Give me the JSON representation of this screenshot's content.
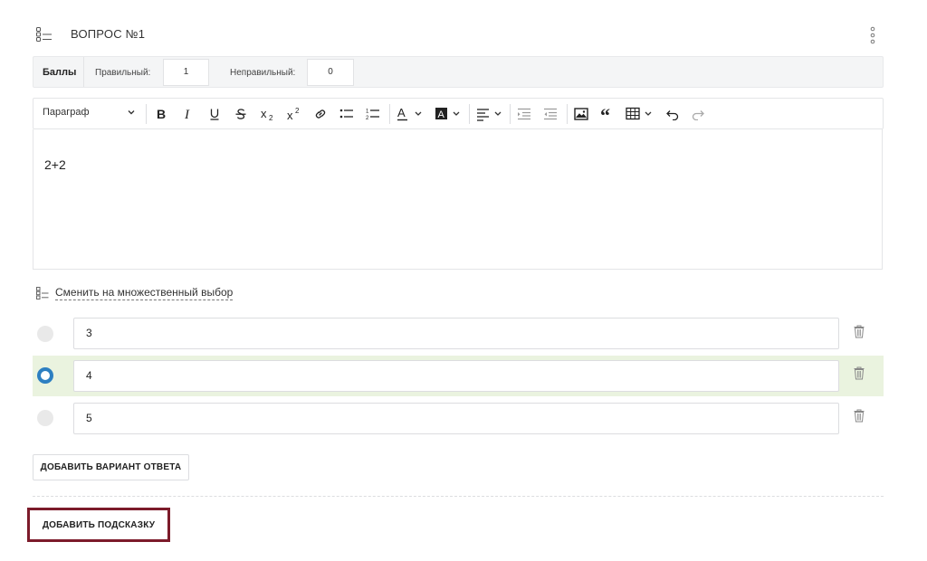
{
  "question": {
    "title": "ВОПРОС №1",
    "icon": "question-list-icon"
  },
  "points": {
    "label": "Баллы",
    "correct_label": "Правильный:",
    "correct_value": "1",
    "incorrect_label": "Неправильный:",
    "incorrect_value": "0"
  },
  "toolbar": {
    "paragraph_label": "Параграф",
    "icons": [
      "bold-icon",
      "italic-icon",
      "underline-icon",
      "strikethrough-icon",
      "subscript-icon",
      "superscript-icon",
      "link-icon",
      "bulleted-list-icon",
      "numbered-list-icon",
      "font-color-icon",
      "font-background-icon",
      "align-icon",
      "outdent-icon",
      "indent-icon",
      "image-icon",
      "blockquote-icon",
      "table-icon",
      "undo-icon",
      "redo-icon"
    ]
  },
  "editor": {
    "content": "2+2"
  },
  "switch": {
    "label": "Сменить на множественный выбор"
  },
  "answers": [
    {
      "value": "3",
      "selected": false
    },
    {
      "value": "4",
      "selected": true
    },
    {
      "value": "5",
      "selected": false
    }
  ],
  "buttons": {
    "add_variant": "ДОБАВИТЬ ВАРИАНТ ОТВЕТА",
    "add_hint": "ДОБАВИТЬ ПОДСКАЗКУ"
  },
  "colors": {
    "accent": "#2d7fc1",
    "selected_row": "#eaf3df",
    "highlight_border": "#7c1b2a"
  }
}
